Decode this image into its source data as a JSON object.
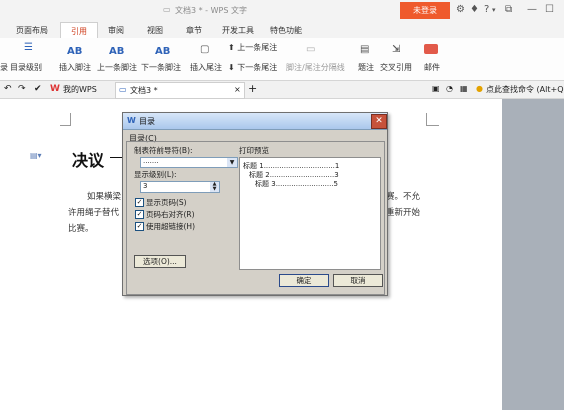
{
  "window": {
    "doc_title": "文档3 * - WPS 文字",
    "login_label": "未登录"
  },
  "menu_tabs": [
    "页面布局",
    "引用",
    "审阅",
    "视图",
    "章节",
    "开发工具",
    "特色功能"
  ],
  "ribbon": {
    "left_cut": "录",
    "toc_level": "目录级别",
    "insert_footnote": "插入脚注",
    "prev_footnote": "上一条脚注",
    "next_footnote": "下一条脚注",
    "insert_endnote": "插入尾注",
    "prev_endnote": "上一条尾注",
    "next_endnote": "下一条尾注",
    "footnote_separator": "脚注/尾注分隔线",
    "caption": "题注",
    "cross_reference": "交叉引用",
    "mail": "邮件"
  },
  "quickbar": {
    "my_wps": "我的WPS",
    "doc_tab": "文档3 *",
    "search_hint": "点此查找命令 (Alt+Q)"
  },
  "document": {
    "heading": "决议",
    "line1_left": "如果横梁",
    "line1_right": "赛。不允",
    "line2_left": "许用绳子替代",
    "line2_right": "重新开始",
    "line3_left": "比赛。"
  },
  "dialog": {
    "title": "目录",
    "group_label": "目录(C)",
    "tab_leader_label": "制表符前导符(B):",
    "tab_leader_value": ".......",
    "show_levels_label": "显示级别(L):",
    "show_levels_value": "3",
    "show_page_numbers": "显示页码(S)",
    "right_align_page_numbers": "页码右对齐(R)",
    "use_hyperlinks": "使用超链接(H)",
    "options_button": "选项(O)...",
    "preview_label": "打印预览",
    "preview_lines": [
      {
        "text": "标题 1",
        "dots": "................................",
        "page": "1"
      },
      {
        "text": "标题 2",
        "dots": ".............................",
        "page": "3"
      },
      {
        "text": "标题 3",
        "dots": "..........................",
        "page": "5"
      }
    ],
    "ok_button": "确定",
    "cancel_button": "取消"
  }
}
